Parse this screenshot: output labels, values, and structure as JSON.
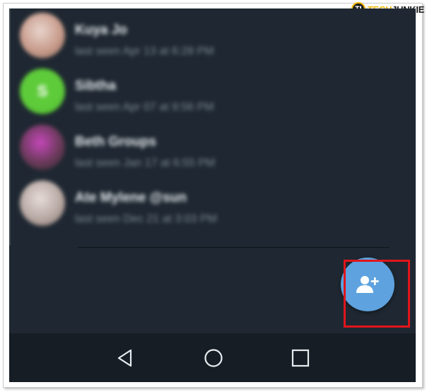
{
  "watermark": {
    "badge": "TJ",
    "brand_prefix": "TECH",
    "brand_suffix": "JUNKIE"
  },
  "contacts": [
    {
      "name": "Kuya Jo",
      "status": "last seen Apr 13 at 6:28 PM",
      "avatar_initial": "",
      "avatar_colors": [
        "#c89c8c",
        "#e8d4cc",
        "#8a6a5a"
      ]
    },
    {
      "name": "Sibtha",
      "status": "last seen Apr 07 at 9:56 PM",
      "avatar_initial": "S",
      "avatar_colors": [
        "#5ecb3a",
        "#5ecb3a",
        "#4fb52f"
      ]
    },
    {
      "name": "Beth Groups",
      "status": "last seen Jan 17 at 6:55 PM",
      "avatar_initial": "",
      "avatar_colors": [
        "#6a3a5a",
        "#c447b8",
        "#2a2a2a"
      ]
    },
    {
      "name": "Ate Mylene @sun",
      "status": "last seen Dec 21 at 3:03 PM",
      "avatar_initial": "",
      "avatar_colors": [
        "#b8a9a4",
        "#e6dcd8",
        "#7c6d68"
      ]
    }
  ],
  "fab": {
    "icon": "add-contact-icon",
    "color": "#5ea2df"
  },
  "highlight_color": "#e0151b",
  "nav": {
    "back_icon": "back-triangle-icon",
    "home_icon": "home-circle-icon",
    "recents_icon": "recents-square-icon"
  }
}
